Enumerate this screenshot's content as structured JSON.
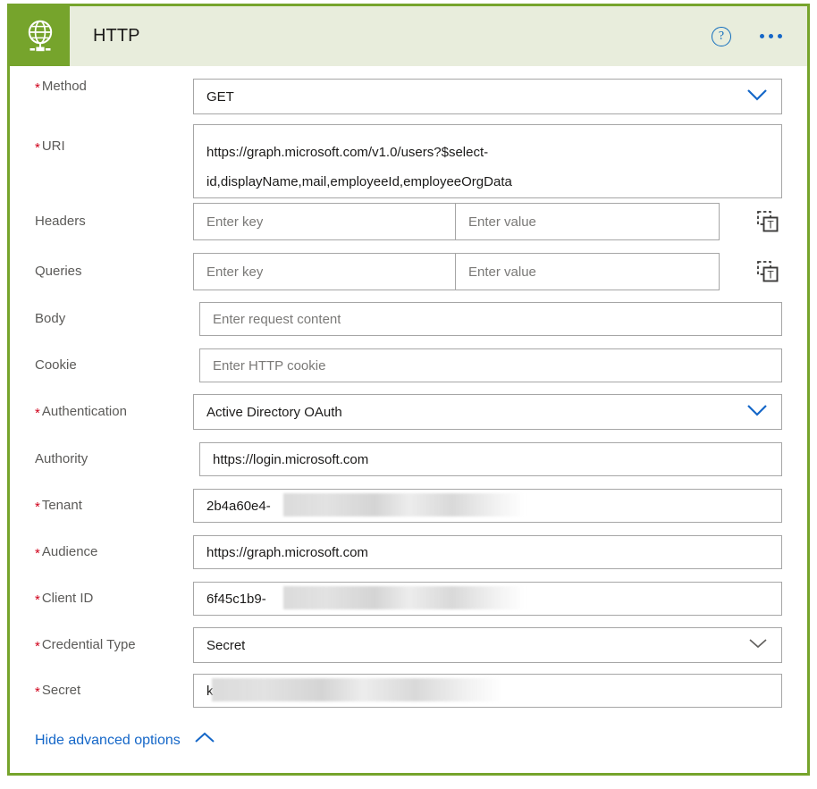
{
  "header": {
    "title": "HTTP",
    "icon": "globe-http-icon",
    "help_label": "?",
    "more_label": "•••",
    "accent_color": "#76A42C",
    "band_color": "#E8EDDC"
  },
  "form": {
    "fields": [
      {
        "id": "method",
        "label": "Method",
        "required": true,
        "control": "dropdown",
        "value": "GET"
      },
      {
        "id": "uri",
        "label": "URI",
        "required": true,
        "control": "textarea",
        "value_line1": "https://graph.microsoft.com/v1.0/users?$select-",
        "value_line2": "id,displayName,mail,employeeId,employeeOrgData"
      },
      {
        "id": "headers",
        "label": "Headers",
        "required": false,
        "control": "keyvalue",
        "key_placeholder": "Enter key",
        "value_placeholder": "Enter value",
        "action_icon": "switch-to-text-mode-icon"
      },
      {
        "id": "queries",
        "label": "Queries",
        "required": false,
        "control": "keyvalue",
        "key_placeholder": "Enter key",
        "value_placeholder": "Enter value",
        "action_icon": "switch-to-text-mode-icon"
      },
      {
        "id": "body",
        "label": "Body",
        "required": false,
        "control": "text",
        "placeholder": "Enter request content",
        "value": ""
      },
      {
        "id": "cookie",
        "label": "Cookie",
        "required": false,
        "control": "text",
        "placeholder": "Enter HTTP cookie",
        "value": ""
      },
      {
        "id": "authentication",
        "label": "Authentication",
        "required": true,
        "control": "dropdown",
        "value": "Active Directory OAuth"
      },
      {
        "id": "authority",
        "label": "Authority",
        "required": false,
        "control": "text",
        "value": "https://login.microsoft.com"
      },
      {
        "id": "tenant",
        "label": "Tenant",
        "required": true,
        "control": "text",
        "value": "2b4a60e4-",
        "redacted": true
      },
      {
        "id": "audience",
        "label": "Audience",
        "required": true,
        "control": "text",
        "value": "https://graph.microsoft.com"
      },
      {
        "id": "client_id",
        "label": "Client ID",
        "required": true,
        "control": "text",
        "value": "6f45c1b9-",
        "redacted": true
      },
      {
        "id": "credential_type",
        "label": "Credential Type",
        "required": true,
        "control": "dropdown",
        "value": "Secret"
      },
      {
        "id": "secret",
        "label": "Secret",
        "required": true,
        "control": "text",
        "value": "k",
        "redacted": true
      }
    ],
    "advanced_toggle": {
      "label": "Hide advanced options",
      "icon": "chevron-up-icon",
      "color": "#1567C8"
    },
    "required_marker": "*"
  }
}
